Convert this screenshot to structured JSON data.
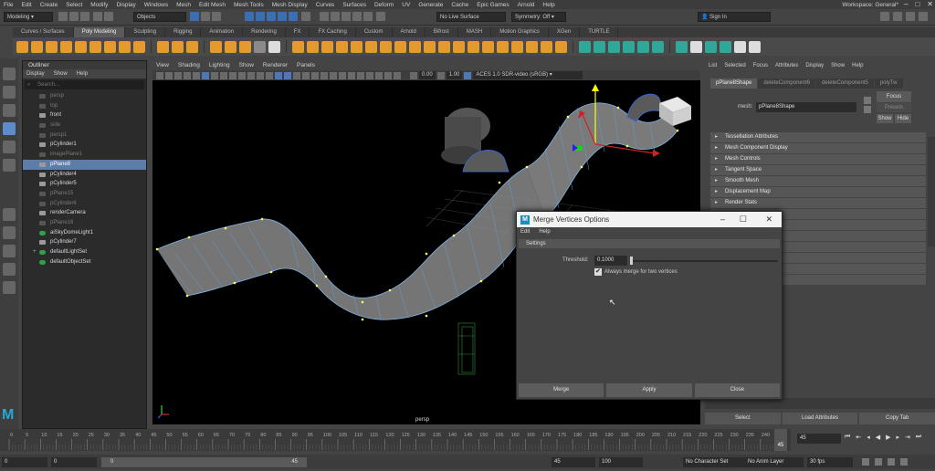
{
  "menubar": {
    "items": [
      "File",
      "Edit",
      "Create",
      "Select",
      "Modify",
      "Display",
      "Windows",
      "Mesh",
      "Edit Mesh",
      "Mesh Tools",
      "Mesh Display",
      "Curves",
      "Surfaces",
      "Deform",
      "UV",
      "Generate",
      "Cache",
      "Epic Games",
      "Arnold",
      "Help"
    ],
    "workspace": "Workspace: General*"
  },
  "statusline": {
    "menuset": "Modeling",
    "objects": "Objects",
    "live_surface": "No Live Surface",
    "symmetry": "Symmetry: Off",
    "sign_in": "Sign In"
  },
  "shelf_tabs": [
    "Curves / Surfaces",
    "Poly Modeling",
    "Sculpting",
    "Rigging",
    "Animation",
    "Rendering",
    "FX",
    "FX Caching",
    "Custom",
    "Arnold",
    "Bifrost",
    "MASH",
    "Motion Graphics",
    "XGen",
    "TURTLE"
  ],
  "shelf_active": 1,
  "outliner": {
    "title": "Outliner",
    "menu": [
      "Display",
      "Show",
      "Help"
    ],
    "search_placeholder": "Search...",
    "items": [
      {
        "label": "persp",
        "dim": true,
        "icon": "camera"
      },
      {
        "label": "top",
        "dim": true,
        "icon": "camera"
      },
      {
        "label": "front",
        "dim": false,
        "icon": "camera"
      },
      {
        "label": "side",
        "dim": true,
        "icon": "camera"
      },
      {
        "label": "persp1",
        "dim": true,
        "icon": "camera"
      },
      {
        "label": "pCylinder1",
        "dim": false,
        "icon": "mesh"
      },
      {
        "label": "imagePlane1",
        "dim": true,
        "icon": "mesh"
      },
      {
        "label": "pPlane8",
        "dim": false,
        "icon": "mesh",
        "selected": true
      },
      {
        "label": "pCylinder4",
        "dim": false,
        "icon": "mesh"
      },
      {
        "label": "pCylinder5",
        "dim": false,
        "icon": "mesh"
      },
      {
        "label": "pPlane15",
        "dim": true,
        "icon": "mesh"
      },
      {
        "label": "pCylinder6",
        "dim": true,
        "icon": "mesh"
      },
      {
        "label": "renderCamera",
        "dim": false,
        "icon": "camera"
      },
      {
        "label": "pPlane16",
        "dim": true,
        "icon": "mesh"
      },
      {
        "label": "aiSkyDomeLight1",
        "dim": false,
        "icon": "light"
      },
      {
        "label": "pCylinder7",
        "dim": false,
        "icon": "mesh"
      },
      {
        "label": "defaultLightSet",
        "dim": false,
        "icon": "set",
        "expand": true
      },
      {
        "label": "defaultObjectSet",
        "dim": false,
        "icon": "set"
      }
    ]
  },
  "viewport": {
    "menu": [
      "View",
      "Shading",
      "Lighting",
      "Show",
      "Renderer",
      "Panels"
    ],
    "exposure": "0.00",
    "gamma": "1.00",
    "colorspace": "ACES 1.0 SDR-video (sRGB)",
    "camera_label": "persp"
  },
  "attribute_editor": {
    "menu": [
      "List",
      "Selected",
      "Focus",
      "Attributes",
      "Display",
      "Show",
      "Help"
    ],
    "tabs": [
      "pPlane8Shape",
      "deleteComponent6",
      "deleteComponent5",
      "polyTw"
    ],
    "focus": "Focus",
    "presets": "Presets",
    "show": "Show",
    "hide": "Hide",
    "mesh_label": "mesh:",
    "mesh_value": "pPlane8Shape",
    "sections": [
      "Tessellation Attributes",
      "Mesh Component Display",
      "Mesh Controls",
      "Tangent Space",
      "Smooth Mesh",
      "Displacement Map",
      "Render Stats"
    ],
    "buttons": [
      "Select",
      "Load Attributes",
      "Copy Tab"
    ]
  },
  "dialog": {
    "title": "Merge Vertices Options",
    "menu": [
      "Edit",
      "Help"
    ],
    "section": "Settings",
    "threshold_label": "Threshold:",
    "threshold_value": "0.1000",
    "checkbox_label": "Always merge for two vertices",
    "checkbox_checked": true,
    "buttons": [
      "Merge",
      "Apply",
      "Close"
    ]
  },
  "timeline": {
    "ticks": [
      "0",
      "5",
      "10",
      "15",
      "20",
      "25",
      "30",
      "35",
      "40",
      "45",
      "50",
      "55",
      "60",
      "65",
      "70",
      "75",
      "80",
      "85",
      "90",
      "95",
      "100",
      "105",
      "110",
      "115",
      "120",
      "125",
      "130",
      "135",
      "140",
      "145",
      "150",
      "155",
      "160",
      "165",
      "170",
      "175",
      "180",
      "185",
      "190",
      "195",
      "200",
      "205",
      "210",
      "215",
      "220",
      "225",
      "230",
      "235",
      "240",
      "245"
    ],
    "current_frame": "45",
    "current_frame_field": "45"
  },
  "range": {
    "start": "0",
    "anim_start": "0",
    "slider_start": "0",
    "slider_end": "45",
    "anim_end": "45",
    "end": "100",
    "character_set": "No Character Set",
    "anim_layer": "No Anim Layer",
    "fps": "30 fps"
  }
}
